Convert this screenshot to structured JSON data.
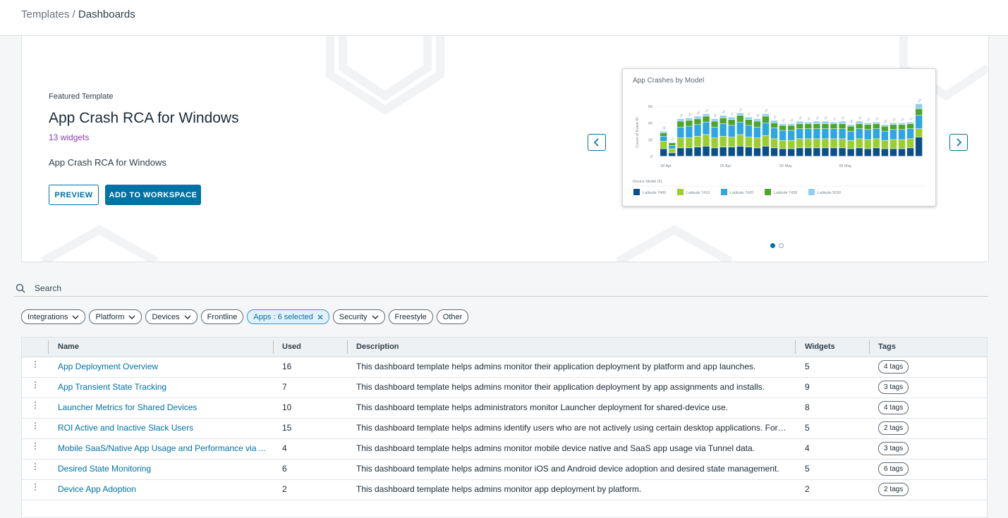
{
  "breadcrumb": {
    "parent": "Templates",
    "separator": "/",
    "current": "Dashboards"
  },
  "featured": {
    "label": "Featured Template",
    "title": "App Crash RCA for Windows",
    "widgets": "13 widgets",
    "description": "App Crash RCA for Windows",
    "preview_label": "PREVIEW",
    "add_label": "ADD TO WORKSPACE"
  },
  "preview_chart": {
    "title": "App Crashes by Model",
    "legend_title": "Device Model (5)",
    "colors": [
      "#0b4f8a",
      "#9bcf2f",
      "#2ea6e3",
      "#4da52a",
      "#8fd0f2"
    ],
    "chart_data": {
      "type": "bar",
      "stacked": true,
      "title": "App Crashes by Model",
      "ylabel": "Count of Event ID",
      "ylim": [
        0,
        60
      ],
      "yticks": [
        "0",
        "20",
        "40",
        "60"
      ],
      "xticks": [
        "18 Apr",
        "25 Apr",
        "02 May",
        "09 May"
      ],
      "totals": [
        30,
        17,
        45,
        46,
        48,
        51,
        45,
        49,
        47,
        52,
        47,
        45,
        51,
        43,
        39,
        39,
        42,
        41,
        42,
        42,
        41,
        42,
        38,
        42,
        40,
        41,
        38,
        40,
        40,
        41,
        63
      ],
      "series": [
        {
          "name": "Latitude 7400",
          "values": [
            9,
            4,
            10,
            10,
            11,
            12,
            10,
            11,
            11,
            12,
            11,
            10,
            12,
            10,
            9,
            9,
            10,
            10,
            10,
            10,
            10,
            10,
            9,
            10,
            9,
            10,
            9,
            9,
            9,
            10,
            23
          ]
        },
        {
          "name": "Latitude 7410",
          "values": [
            9,
            5,
            12,
            12,
            13,
            14,
            12,
            13,
            12,
            14,
            12,
            12,
            13,
            11,
            10,
            10,
            11,
            11,
            11,
            11,
            11,
            11,
            10,
            11,
            11,
            11,
            10,
            11,
            11,
            11,
            10
          ]
        },
        {
          "name": "Latitude 7420",
          "values": [
            6,
            4,
            13,
            14,
            14,
            15,
            13,
            15,
            14,
            15,
            14,
            13,
            15,
            13,
            12,
            12,
            12,
            12,
            12,
            12,
            12,
            12,
            11,
            12,
            12,
            12,
            11,
            12,
            12,
            12,
            16
          ]
        },
        {
          "name": "Latitude 7430",
          "values": [
            4,
            3,
            7,
            7,
            7,
            7,
            7,
            7,
            7,
            8,
            7,
            7,
            8,
            6,
            6,
            6,
            6,
            6,
            6,
            6,
            6,
            6,
            6,
            6,
            6,
            6,
            6,
            6,
            6,
            6,
            8
          ]
        },
        {
          "name": "Latitude 5530",
          "values": [
            2,
            1,
            3,
            3,
            3,
            3,
            3,
            3,
            3,
            3,
            3,
            3,
            3,
            3,
            2,
            2,
            3,
            2,
            3,
            3,
            2,
            3,
            2,
            3,
            2,
            2,
            2,
            2,
            2,
            2,
            6
          ]
        }
      ]
    }
  },
  "search": {
    "placeholder": "Search"
  },
  "filters": [
    "Integrations",
    "Platform",
    "Devices",
    "Frontline",
    "Apps : 6 selected",
    "Security",
    "Freestyle",
    "Other"
  ],
  "table": {
    "headers": {
      "name": "Name",
      "used": "Used",
      "description": "Description",
      "widgets": "Widgets",
      "tags": "Tags"
    },
    "rows": [
      {
        "name": "App Deployment Overview",
        "used": "16",
        "description": "This dashboard template helps admins monitor their application deployment by platform and app launches.",
        "widgets": "5",
        "tags": "4 tags"
      },
      {
        "name": "App Transient State Tracking",
        "used": "7",
        "description": "This dashboard template helps admins monitor their application deployment by app assignments and installs.",
        "widgets": "9",
        "tags": "3 tags"
      },
      {
        "name": "Launcher Metrics for Shared Devices",
        "used": "10",
        "description": "This dashboard template helps administrators monitor Launcher deployment for shared-device use.",
        "widgets": "8",
        "tags": "4 tags"
      },
      {
        "name": "ROI Active and Inactive Slack Users",
        "used": "15",
        "description": "This dashboard template helps admins identify users who are not actively using certain desktop applications. For a...",
        "widgets": "5",
        "tags": "2 tags"
      },
      {
        "name": "Mobile SaaS/Native App Usage and Performance via ...",
        "used": "4",
        "description": "This dashboard template helps admins monitor mobile device native and SaaS app usage via Tunnel data.",
        "widgets": "4",
        "tags": "3 tags"
      },
      {
        "name": "Desired State Monitoring",
        "used": "6",
        "description": "This dashboard template helps admins monitor iOS and Android device adoption and desired state management.",
        "widgets": "5",
        "tags": "6 tags"
      },
      {
        "name": "Device App Adoption",
        "used": "2",
        "description": "This dashboard template helps admins monitor app deployment by platform.",
        "widgets": "2",
        "tags": "2 tags"
      }
    ]
  }
}
